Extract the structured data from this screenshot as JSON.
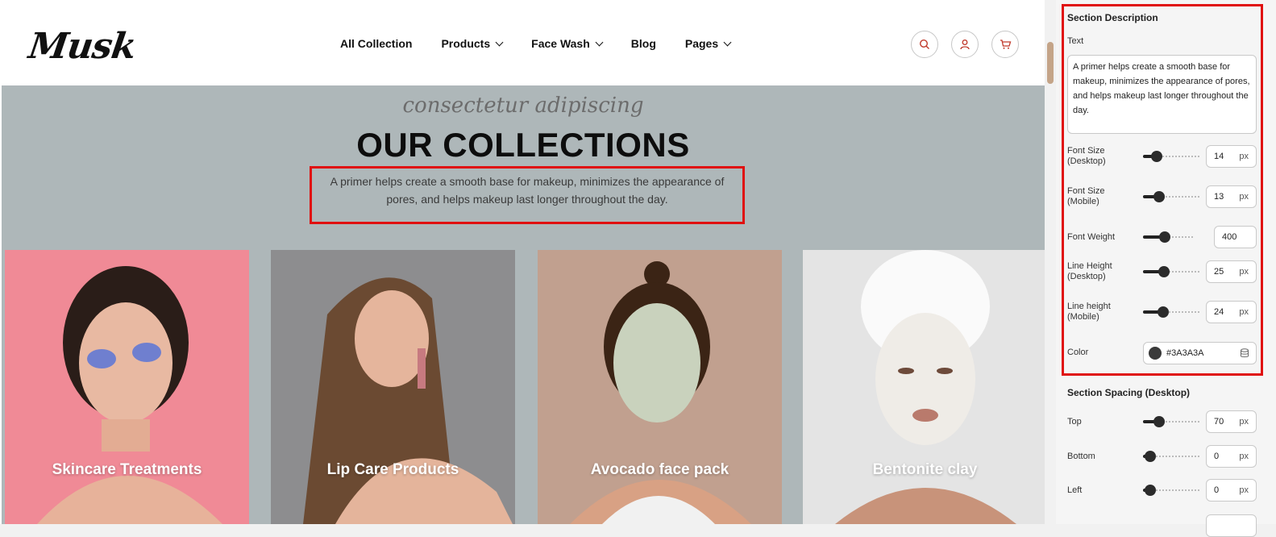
{
  "header": {
    "logo": "Musk",
    "nav": [
      {
        "label": "All Collection",
        "has_dropdown": false
      },
      {
        "label": "Products",
        "has_dropdown": true
      },
      {
        "label": "Face Wash",
        "has_dropdown": true
      },
      {
        "label": "Blog",
        "has_dropdown": false
      },
      {
        "label": "Pages",
        "has_dropdown": true
      }
    ],
    "icons": [
      "search-icon",
      "user-icon",
      "cart-icon"
    ]
  },
  "hero": {
    "subtitle": "consectetur adipiscing",
    "title": "OUR COLLECTIONS",
    "description_line1": "A primer helps create a smooth base for makeup, minimizes the appearance of",
    "description_line2": "pores, and helps makeup last longer throughout the day.",
    "background": "#aeb7b9"
  },
  "cards": [
    {
      "label": "Skincare Treatments",
      "bg": "#f08a96"
    },
    {
      "label": "Lip Care Products",
      "bg": "#8d8d8f"
    },
    {
      "label": "Avocado face pack",
      "bg": "#c1a08f"
    },
    {
      "label": "Bentonite clay",
      "bg": "#e4e4e4"
    }
  ],
  "panel": {
    "section_description": "Section Description",
    "text_label": "Text",
    "text_value": "A primer helps create a smooth base for makeup, minimizes the appearance of pores, and helps makeup last longer throughout the day.",
    "fields": [
      {
        "label_1": "Font Size",
        "label_2": "(Desktop)",
        "value": "14",
        "unit": "px",
        "level": 0.15
      },
      {
        "label_1": "Font Size",
        "label_2": "(Mobile)",
        "value": "13",
        "unit": "px",
        "level": 0.2
      },
      {
        "label_1": "Font Weight",
        "label_2": "",
        "value": "400",
        "unit": "",
        "level": 0.4
      },
      {
        "label_1": "Line Height",
        "label_2": "(Desktop)",
        "value": "25",
        "unit": "px",
        "level": 0.3
      },
      {
        "label_1": "Line height",
        "label_2": "(Mobile)",
        "value": "24",
        "unit": "px",
        "level": 0.28
      }
    ],
    "color_label": "Color",
    "color_value": "#3A3A3A",
    "spacing_heading": "Section Spacing (Desktop)",
    "spacing": [
      {
        "label": "Top",
        "value": "70",
        "unit": "px",
        "level": 0.2
      },
      {
        "label": "Bottom",
        "value": "0",
        "unit": "px",
        "level": 0.0
      },
      {
        "label": "Left",
        "value": "0",
        "unit": "px",
        "level": 0.0
      }
    ],
    "accent": "#e01010"
  }
}
